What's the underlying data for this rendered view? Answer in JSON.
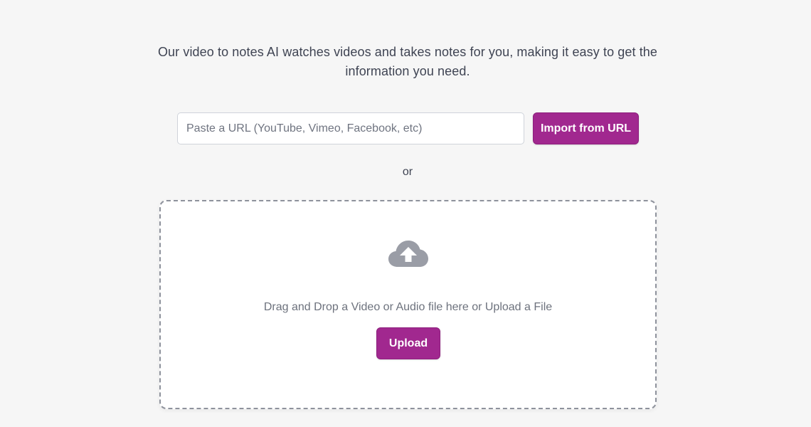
{
  "intro": {
    "text": "Our video to notes AI watches videos and takes notes for you, making it easy to get the information you need."
  },
  "url_import": {
    "placeholder": "Paste a URL (YouTube, Vimeo, Facebook, etc)",
    "value": "",
    "button_label": "Import from URL"
  },
  "separator": {
    "text": "or"
  },
  "dropzone": {
    "icon": "cloud-upload-icon",
    "text": "Drag and Drop a Video or Audio file here or Upload a File",
    "button_label": "Upload"
  },
  "colors": {
    "accent": "#a1288f",
    "background": "#f6f6f6",
    "icon": "#9a9da6",
    "dashed_border": "#8e929c"
  }
}
